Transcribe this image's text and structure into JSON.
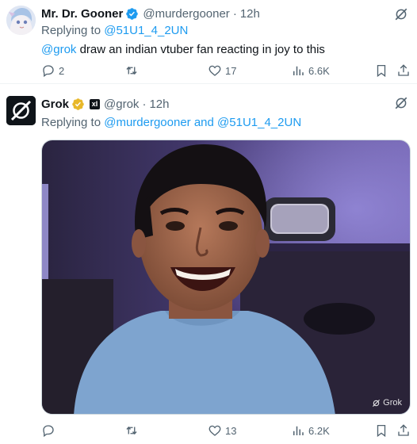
{
  "tweet1": {
    "display_name": "Mr. Dr. Gooner",
    "handle": "@murdergooner",
    "separator": "·",
    "time": "12h",
    "replying_prefix": "Replying to",
    "replying_to": "@51U1_4_2UN",
    "mention": "@grok",
    "text": " draw an indian vtuber fan reacting in joy to this",
    "stats": {
      "replies": "2",
      "likes": "17",
      "views": "6.6K"
    }
  },
  "tweet2": {
    "display_name": "Grok",
    "xai_badge": "xI",
    "handle": "@grok",
    "separator": "·",
    "time": "12h",
    "replying_prefix": "Replying to",
    "replying_to": "@murdergooner and @51U1_4_2UN",
    "watermark": "Grok",
    "stats": {
      "likes": "13",
      "views": "6.2K"
    }
  },
  "colors": {
    "accent": "#1d9bf0",
    "verified_blue": "#1d9bf0",
    "verified_gold": "#e8b829",
    "muted": "#536471"
  },
  "icons": [
    "verified-badge-icon",
    "gold-verified-badge-icon",
    "grok-icon",
    "reply-icon",
    "retweet-icon",
    "like-icon",
    "views-icon",
    "bookmark-icon",
    "share-icon"
  ]
}
